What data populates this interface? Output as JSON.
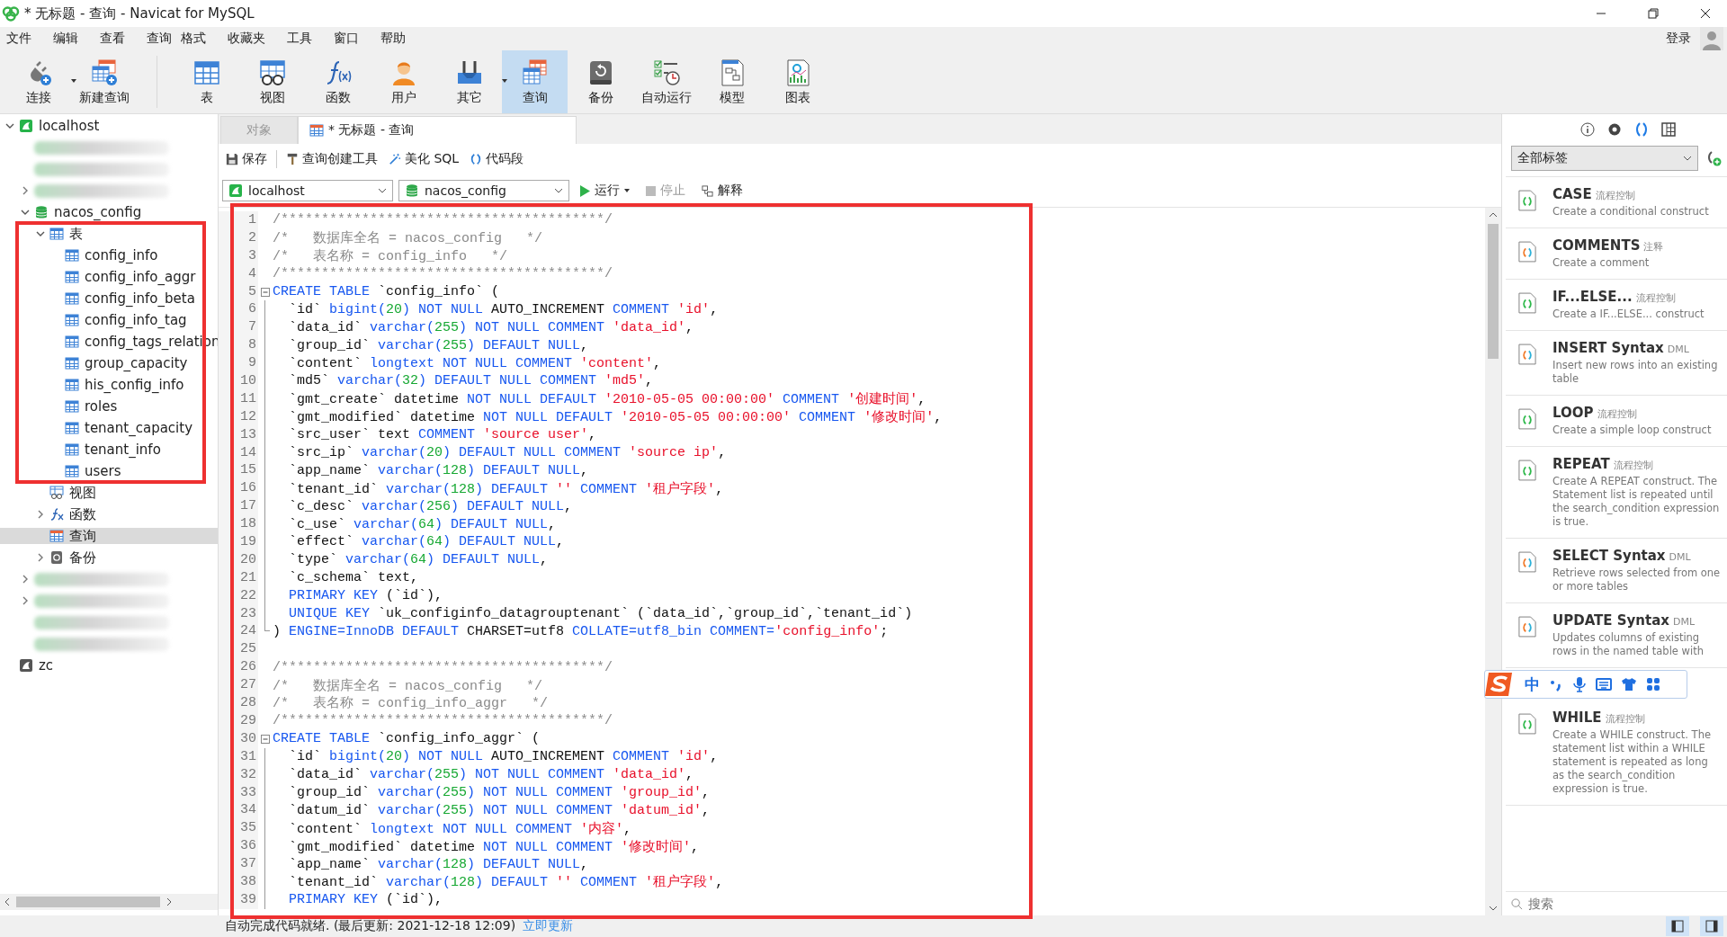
{
  "window": {
    "title": "* 无标题 - 查询 - Navicat for MySQL"
  },
  "menu": [
    "文件",
    "编辑",
    "查看",
    "查询",
    "格式",
    "收藏夹",
    "工具",
    "窗口",
    "帮助"
  ],
  "account": {
    "label": "登录"
  },
  "toolbar": [
    {
      "label": "连接",
      "kind": "connection",
      "menu": true,
      "selected": false
    },
    {
      "label": "新建查询",
      "kind": "new-query",
      "menu": false,
      "selected": false
    },
    {
      "label": "表",
      "kind": "table",
      "menu": false,
      "selected": false
    },
    {
      "label": "视图",
      "kind": "view",
      "menu": false,
      "selected": false
    },
    {
      "label": "函数",
      "kind": "function",
      "menu": false,
      "selected": false
    },
    {
      "label": "用户",
      "kind": "user",
      "menu": false,
      "selected": false
    },
    {
      "label": "其它",
      "kind": "other",
      "menu": true,
      "selected": false
    },
    {
      "label": "查询",
      "kind": "query",
      "menu": false,
      "selected": true
    },
    {
      "label": "备份",
      "kind": "backup",
      "menu": false,
      "selected": false
    },
    {
      "label": "自动运行",
      "kind": "automation",
      "menu": false,
      "selected": false
    },
    {
      "label": "模型",
      "kind": "model",
      "menu": false,
      "selected": false
    },
    {
      "label": "图表",
      "kind": "chart",
      "menu": false,
      "selected": false
    }
  ],
  "sidebar": {
    "tree": [
      {
        "label": "localhost",
        "kind": "connection",
        "expanded": true,
        "selected": false,
        "children": [
          {
            "kind": "blurred",
            "selected": false
          },
          {
            "kind": "blurred",
            "selected": false
          },
          {
            "kind": "blurred",
            "expanded": false,
            "selected": false
          },
          {
            "label": "nacos_config",
            "kind": "database",
            "expanded": true,
            "selected": false,
            "children": [
              {
                "label": "表",
                "kind": "tables",
                "expanded": true,
                "selected": false,
                "children": [
                  {
                    "label": "config_info",
                    "kind": "table",
                    "selected": false
                  },
                  {
                    "label": "config_info_aggr",
                    "kind": "table",
                    "selected": false
                  },
                  {
                    "label": "config_info_beta",
                    "kind": "table",
                    "selected": false
                  },
                  {
                    "label": "config_info_tag",
                    "kind": "table",
                    "selected": false
                  },
                  {
                    "label": "config_tags_relation",
                    "kind": "table",
                    "selected": false
                  },
                  {
                    "label": "group_capacity",
                    "kind": "table",
                    "selected": false
                  },
                  {
                    "label": "his_config_info",
                    "kind": "table",
                    "selected": false
                  },
                  {
                    "label": "roles",
                    "kind": "table",
                    "selected": false
                  },
                  {
                    "label": "tenant_capacity",
                    "kind": "table",
                    "selected": false
                  },
                  {
                    "label": "tenant_info",
                    "kind": "table",
                    "selected": false
                  },
                  {
                    "label": "users",
                    "kind": "table",
                    "selected": false
                  }
                ]
              },
              {
                "label": "视图",
                "kind": "views",
                "selected": false
              },
              {
                "label": "函数",
                "kind": "functions",
                "expanded": false,
                "selected": false
              },
              {
                "label": "查询",
                "kind": "queries",
                "selected": true
              },
              {
                "label": "备份",
                "kind": "backups",
                "expanded": false,
                "selected": false
              }
            ]
          },
          {
            "kind": "blurred",
            "expanded": false,
            "selected": false
          },
          {
            "kind": "blurred",
            "expanded": false,
            "selected": false
          },
          {
            "kind": "blurred",
            "selected": false
          },
          {
            "kind": "blurred",
            "selected": false
          }
        ]
      },
      {
        "label": "zc",
        "kind": "connection-grey",
        "selected": false
      }
    ]
  },
  "tabs": [
    {
      "label": "对象",
      "selected": false
    },
    {
      "label": "* 无标题 - 查询",
      "selected": true
    }
  ],
  "query_toolbar": [
    {
      "label": "保存",
      "kind": "save"
    },
    {
      "label": "查询创建工具",
      "kind": "builder"
    },
    {
      "label": "美化 SQL",
      "kind": "beautify"
    },
    {
      "label": "代码段",
      "kind": "snippet"
    }
  ],
  "connection": {
    "value": "localhost"
  },
  "database": {
    "value": "nacos_config"
  },
  "actions": [
    {
      "label": "运行",
      "kind": "run",
      "menu": true,
      "disabled": false
    },
    {
      "label": "停止",
      "kind": "stop",
      "menu": false,
      "disabled": true
    },
    {
      "label": "解释",
      "kind": "explain",
      "menu": false,
      "disabled": false
    }
  ],
  "editor": {
    "lines": [
      {
        "number": "1",
        "segments": [
          {
            "kind": "c",
            "text": "/****************************************/"
          }
        ]
      },
      {
        "number": "2",
        "segments": [
          {
            "kind": "c",
            "text": "/*   数据库全名 = nacos_config   */"
          }
        ]
      },
      {
        "number": "3",
        "segments": [
          {
            "kind": "c",
            "text": "/*   表名称 = config_info   */"
          }
        ]
      },
      {
        "number": "4",
        "segments": [
          {
            "kind": "c",
            "text": "/****************************************/"
          }
        ]
      },
      {
        "number": "5",
        "fold_open": true,
        "segments": [
          {
            "kind": "k",
            "text": "CREATE TABLE"
          },
          {
            "kind": "p",
            "text": " `config_info` ("
          }
        ]
      },
      {
        "number": "6",
        "in_fold": true,
        "segments": [
          {
            "kind": "p",
            "text": "  `id` "
          },
          {
            "kind": "k",
            "text": "bigint("
          },
          {
            "kind": "n",
            "text": "20"
          },
          {
            "kind": "k",
            "text": ") NOT NULL"
          },
          {
            "kind": "p",
            "text": " AUTO_INCREMENT "
          },
          {
            "kind": "k",
            "text": "COMMENT "
          },
          {
            "kind": "s",
            "text": "'id'"
          },
          {
            "kind": "p",
            "text": ","
          }
        ]
      },
      {
        "number": "7",
        "in_fold": true,
        "segments": [
          {
            "kind": "p",
            "text": "  `data_id` "
          },
          {
            "kind": "k",
            "text": "varchar("
          },
          {
            "kind": "n",
            "text": "255"
          },
          {
            "kind": "k",
            "text": ") NOT NULL COMMENT "
          },
          {
            "kind": "s",
            "text": "'data_id'"
          },
          {
            "kind": "p",
            "text": ","
          }
        ]
      },
      {
        "number": "8",
        "in_fold": true,
        "segments": [
          {
            "kind": "p",
            "text": "  `group_id` "
          },
          {
            "kind": "k",
            "text": "varchar("
          },
          {
            "kind": "n",
            "text": "255"
          },
          {
            "kind": "k",
            "text": ") DEFAULT NULL"
          },
          {
            "kind": "p",
            "text": ","
          }
        ]
      },
      {
        "number": "9",
        "in_fold": true,
        "segments": [
          {
            "kind": "p",
            "text": "  `content` "
          },
          {
            "kind": "k",
            "text": "longtext NOT NULL COMMENT "
          },
          {
            "kind": "s",
            "text": "'content'"
          },
          {
            "kind": "p",
            "text": ","
          }
        ]
      },
      {
        "number": "10",
        "in_fold": true,
        "segments": [
          {
            "kind": "p",
            "text": "  `md5` "
          },
          {
            "kind": "k",
            "text": "varchar("
          },
          {
            "kind": "n",
            "text": "32"
          },
          {
            "kind": "k",
            "text": ") DEFAULT NULL COMMENT "
          },
          {
            "kind": "s",
            "text": "'md5'"
          },
          {
            "kind": "p",
            "text": ","
          }
        ]
      },
      {
        "number": "11",
        "in_fold": true,
        "segments": [
          {
            "kind": "p",
            "text": "  `gmt_create` datetime "
          },
          {
            "kind": "k",
            "text": "NOT NULL DEFAULT "
          },
          {
            "kind": "s",
            "text": "'2010-05-05 00:00:00'"
          },
          {
            "kind": "k",
            "text": " COMMENT "
          },
          {
            "kind": "s",
            "text": "'创建时间'"
          },
          {
            "kind": "p",
            "text": ","
          }
        ]
      },
      {
        "number": "12",
        "in_fold": true,
        "segments": [
          {
            "kind": "p",
            "text": "  `gmt_modified` datetime "
          },
          {
            "kind": "k",
            "text": "NOT NULL DEFAULT "
          },
          {
            "kind": "s",
            "text": "'2010-05-05 00:00:00'"
          },
          {
            "kind": "k",
            "text": " COMMENT "
          },
          {
            "kind": "s",
            "text": "'修改时间'"
          },
          {
            "kind": "p",
            "text": ","
          }
        ]
      },
      {
        "number": "13",
        "in_fold": true,
        "segments": [
          {
            "kind": "p",
            "text": "  `src_user` text "
          },
          {
            "kind": "k",
            "text": "COMMENT "
          },
          {
            "kind": "s",
            "text": "'source user'"
          },
          {
            "kind": "p",
            "text": ","
          }
        ]
      },
      {
        "number": "14",
        "in_fold": true,
        "segments": [
          {
            "kind": "p",
            "text": "  `src_ip` "
          },
          {
            "kind": "k",
            "text": "varchar("
          },
          {
            "kind": "n",
            "text": "20"
          },
          {
            "kind": "k",
            "text": ") DEFAULT NULL COMMENT "
          },
          {
            "kind": "s",
            "text": "'source ip'"
          },
          {
            "kind": "p",
            "text": ","
          }
        ]
      },
      {
        "number": "15",
        "in_fold": true,
        "segments": [
          {
            "kind": "p",
            "text": "  `app_name` "
          },
          {
            "kind": "k",
            "text": "varchar("
          },
          {
            "kind": "n",
            "text": "128"
          },
          {
            "kind": "k",
            "text": ") DEFAULT NULL"
          },
          {
            "kind": "p",
            "text": ","
          }
        ]
      },
      {
        "number": "16",
        "in_fold": true,
        "segments": [
          {
            "kind": "p",
            "text": "  `tenant_id` "
          },
          {
            "kind": "k",
            "text": "varchar("
          },
          {
            "kind": "n",
            "text": "128"
          },
          {
            "kind": "k",
            "text": ") DEFAULT "
          },
          {
            "kind": "s",
            "text": "''"
          },
          {
            "kind": "k",
            "text": " COMMENT "
          },
          {
            "kind": "s",
            "text": "'租户字段'"
          },
          {
            "kind": "p",
            "text": ","
          }
        ]
      },
      {
        "number": "17",
        "in_fold": true,
        "segments": [
          {
            "kind": "p",
            "text": "  `c_desc` "
          },
          {
            "kind": "k",
            "text": "varchar("
          },
          {
            "kind": "n",
            "text": "256"
          },
          {
            "kind": "k",
            "text": ") DEFAULT NULL"
          },
          {
            "kind": "p",
            "text": ","
          }
        ]
      },
      {
        "number": "18",
        "in_fold": true,
        "segments": [
          {
            "kind": "p",
            "text": "  `c_use` "
          },
          {
            "kind": "k",
            "text": "varchar("
          },
          {
            "kind": "n",
            "text": "64"
          },
          {
            "kind": "k",
            "text": ") DEFAULT NULL"
          },
          {
            "kind": "p",
            "text": ","
          }
        ]
      },
      {
        "number": "19",
        "in_fold": true,
        "segments": [
          {
            "kind": "p",
            "text": "  `effect` "
          },
          {
            "kind": "k",
            "text": "varchar("
          },
          {
            "kind": "n",
            "text": "64"
          },
          {
            "kind": "k",
            "text": ") DEFAULT NULL"
          },
          {
            "kind": "p",
            "text": ","
          }
        ]
      },
      {
        "number": "20",
        "in_fold": true,
        "segments": [
          {
            "kind": "p",
            "text": "  `type` "
          },
          {
            "kind": "k",
            "text": "varchar("
          },
          {
            "kind": "n",
            "text": "64"
          },
          {
            "kind": "k",
            "text": ") DEFAULT NULL"
          },
          {
            "kind": "p",
            "text": ","
          }
        ]
      },
      {
        "number": "21",
        "in_fold": true,
        "segments": [
          {
            "kind": "p",
            "text": "  `c_schema` text,"
          }
        ]
      },
      {
        "number": "22",
        "in_fold": true,
        "segments": [
          {
            "kind": "k",
            "text": "  PRIMARY KEY"
          },
          {
            "kind": "p",
            "text": " (`id`),"
          }
        ]
      },
      {
        "number": "23",
        "in_fold": true,
        "segments": [
          {
            "kind": "k",
            "text": "  UNIQUE KEY"
          },
          {
            "kind": "p",
            "text": " `uk_configinfo_datagrouptenant` (`data_id`,`group_id`,`tenant_id`)"
          }
        ]
      },
      {
        "number": "24",
        "fold_end": true,
        "segments": [
          {
            "kind": "p",
            "text": ") "
          },
          {
            "kind": "k",
            "text": "ENGINE=InnoDB DEFAULT"
          },
          {
            "kind": "p",
            "text": " CHARSET=utf8 "
          },
          {
            "kind": "k",
            "text": "COLLATE=utf8_bin COMMENT="
          },
          {
            "kind": "s",
            "text": "'config_info'"
          },
          {
            "kind": "p",
            "text": ";"
          }
        ]
      },
      {
        "number": "25"
      },
      {
        "number": "26",
        "segments": [
          {
            "kind": "c",
            "text": "/****************************************/"
          }
        ]
      },
      {
        "number": "27",
        "segments": [
          {
            "kind": "c",
            "text": "/*   数据库全名 = nacos_config   */"
          }
        ]
      },
      {
        "number": "28",
        "segments": [
          {
            "kind": "c",
            "text": "/*   表名称 = config_info_aggr   */"
          }
        ]
      },
      {
        "number": "29",
        "segments": [
          {
            "kind": "c",
            "text": "/****************************************/"
          }
        ]
      },
      {
        "number": "30",
        "fold_open": true,
        "segments": [
          {
            "kind": "k",
            "text": "CREATE TABLE"
          },
          {
            "kind": "p",
            "text": " `config_info_aggr` ("
          }
        ]
      },
      {
        "number": "31",
        "in_fold": true,
        "segments": [
          {
            "kind": "p",
            "text": "  `id` "
          },
          {
            "kind": "k",
            "text": "bigint("
          },
          {
            "kind": "n",
            "text": "20"
          },
          {
            "kind": "k",
            "text": ") NOT NULL"
          },
          {
            "kind": "p",
            "text": " AUTO_INCREMENT "
          },
          {
            "kind": "k",
            "text": "COMMENT "
          },
          {
            "kind": "s",
            "text": "'id'"
          },
          {
            "kind": "p",
            "text": ","
          }
        ]
      },
      {
        "number": "32",
        "in_fold": true,
        "segments": [
          {
            "kind": "p",
            "text": "  `data_id` "
          },
          {
            "kind": "k",
            "text": "varchar("
          },
          {
            "kind": "n",
            "text": "255"
          },
          {
            "kind": "k",
            "text": ") NOT NULL COMMENT "
          },
          {
            "kind": "s",
            "text": "'data_id'"
          },
          {
            "kind": "p",
            "text": ","
          }
        ]
      },
      {
        "number": "33",
        "in_fold": true,
        "segments": [
          {
            "kind": "p",
            "text": "  `group_id` "
          },
          {
            "kind": "k",
            "text": "varchar("
          },
          {
            "kind": "n",
            "text": "255"
          },
          {
            "kind": "k",
            "text": ") NOT NULL COMMENT "
          },
          {
            "kind": "s",
            "text": "'group_id'"
          },
          {
            "kind": "p",
            "text": ","
          }
        ]
      },
      {
        "number": "34",
        "in_fold": true,
        "segments": [
          {
            "kind": "p",
            "text": "  `datum_id` "
          },
          {
            "kind": "k",
            "text": "varchar("
          },
          {
            "kind": "n",
            "text": "255"
          },
          {
            "kind": "k",
            "text": ") NOT NULL COMMENT "
          },
          {
            "kind": "s",
            "text": "'datum_id'"
          },
          {
            "kind": "p",
            "text": ","
          }
        ]
      },
      {
        "number": "35",
        "in_fold": true,
        "segments": [
          {
            "kind": "p",
            "text": "  `content` "
          },
          {
            "kind": "k",
            "text": "longtext NOT NULL COMMENT "
          },
          {
            "kind": "s",
            "text": "'内容'"
          },
          {
            "kind": "p",
            "text": ","
          }
        ]
      },
      {
        "number": "36",
        "in_fold": true,
        "segments": [
          {
            "kind": "p",
            "text": "  `gmt_modified` datetime "
          },
          {
            "kind": "k",
            "text": "NOT NULL COMMENT "
          },
          {
            "kind": "s",
            "text": "'修改时间'"
          },
          {
            "kind": "p",
            "text": ","
          }
        ]
      },
      {
        "number": "37",
        "in_fold": true,
        "segments": [
          {
            "kind": "p",
            "text": "  `app_name` "
          },
          {
            "kind": "k",
            "text": "varchar("
          },
          {
            "kind": "n",
            "text": "128"
          },
          {
            "kind": "k",
            "text": ") DEFAULT NULL"
          },
          {
            "kind": "p",
            "text": ","
          }
        ]
      },
      {
        "number": "38",
        "in_fold": true,
        "segments": [
          {
            "kind": "p",
            "text": "  `tenant_id` "
          },
          {
            "kind": "k",
            "text": "varchar("
          },
          {
            "kind": "n",
            "text": "128"
          },
          {
            "kind": "k",
            "text": ") DEFAULT "
          },
          {
            "kind": "s",
            "text": "''"
          },
          {
            "kind": "k",
            "text": " COMMENT "
          },
          {
            "kind": "s",
            "text": "'租户字段'"
          },
          {
            "kind": "p",
            "text": ","
          }
        ]
      },
      {
        "number": "39",
        "in_fold": true,
        "segments": [
          {
            "kind": "k",
            "text": "  PRIMARY KEY"
          },
          {
            "kind": "p",
            "text": " (`id`),"
          }
        ]
      }
    ]
  },
  "right_panel": {
    "tabs": [
      {
        "kind": "info",
        "selected": false
      },
      {
        "kind": "preview",
        "selected": false
      },
      {
        "kind": "snippets",
        "selected": true
      },
      {
        "kind": "layout",
        "selected": false
      }
    ],
    "filter": {
      "value": "全部标签"
    },
    "snippets": [
      {
        "title": "CASE",
        "tag": "流程控制",
        "description": "Create a conditional construct",
        "kind": "flow"
      },
      {
        "title": "COMMENTS",
        "tag": "注释",
        "description": "Create a comment",
        "kind": "syntax"
      },
      {
        "title": "IF...ELSE...",
        "tag": "流程控制",
        "description": "Create a IF...ELSE... construct",
        "kind": "flow"
      },
      {
        "title": "INSERT Syntax",
        "tag": "DML",
        "description": "Insert new rows into an existing table",
        "kind": "syntax"
      },
      {
        "title": "LOOP",
        "tag": "流程控制",
        "description": "Create a simple loop construct",
        "kind": "flow"
      },
      {
        "title": "REPEAT",
        "tag": "流程控制",
        "description": "Create A REPEAT construct. The Statement list is repeated until the search_condition expression is true.",
        "kind": "flow"
      },
      {
        "title": "SELECT Syntax",
        "tag": "DML",
        "description": "Retrieve rows selected from one or more tables",
        "kind": "syntax"
      },
      {
        "title": "UPDATE Syntax",
        "tag": "DML",
        "description": "Updates columns of existing rows in the named table with",
        "kind": "syntax"
      },
      {
        "title": "WHILE",
        "tag": "流程控制",
        "description": "Create a WHILE construct. The statement list within a WHILE statement is repeated as long as the search_condition expression is true.",
        "kind": "flow"
      }
    ],
    "search": {
      "placeholder": "搜索"
    }
  },
  "ime_toolbar": {
    "mode": "中"
  },
  "status_bar": {
    "message": "自动完成代码就绪. (最后更新: 2021-12-18 12:09)",
    "link": "立即更新"
  }
}
